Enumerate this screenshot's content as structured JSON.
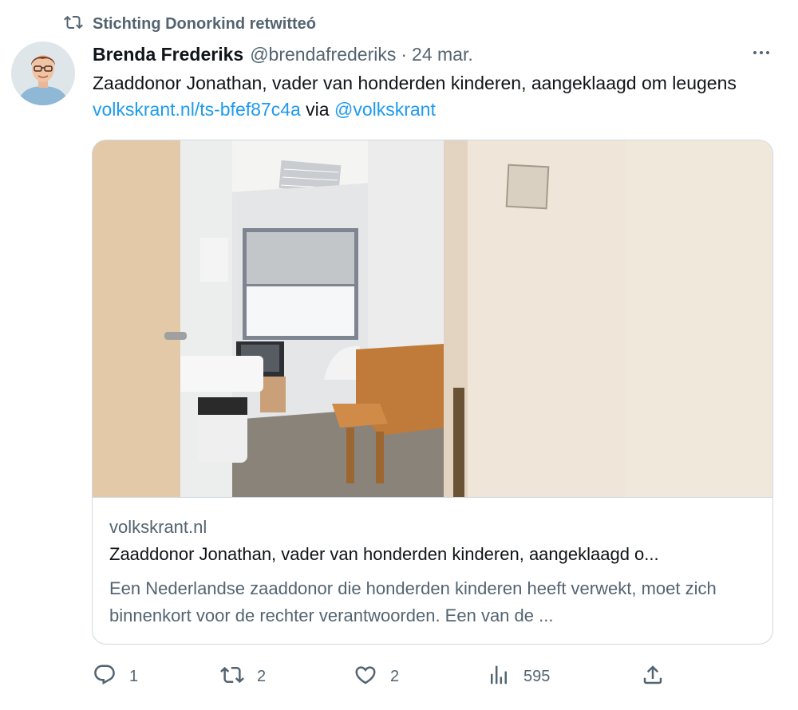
{
  "retweet_banner": {
    "icon": "retweet-icon",
    "label": "Stichting Donorkind retwitteó"
  },
  "tweet": {
    "author_name": "Brenda Frederiks",
    "handle": "@brendafrederiks",
    "separator": "·",
    "date": "24 mar.",
    "more_icon": "more-icon",
    "text_prefix": "Zaaddonor Jonathan, vader van honderden kinderen, aangeklaagd om leugens ",
    "link_text": "volkskrant.nl/ts-bfef87c4a",
    "via_text": " via ",
    "mention": "@volkskrant"
  },
  "card": {
    "domain": "volkskrant.nl",
    "title": "Zaaddonor Jonathan, vader van honderden kinderen, aangeklaagd o...",
    "description": "Een Nederlandse zaaddonor die honderden kinderen heeft verwekt, moet zich binnenkort voor de rechter verantwoorden. Een van de ..."
  },
  "actions": {
    "reply": {
      "icon": "reply-icon",
      "count": "1"
    },
    "retweet": {
      "icon": "retweet-icon",
      "count": "2"
    },
    "like": {
      "icon": "heart-icon",
      "count": "2"
    },
    "views": {
      "icon": "views-icon",
      "count": "595"
    },
    "share": {
      "icon": "share-icon"
    }
  },
  "colors": {
    "accent": "#1d9bf0",
    "secondary_text": "#536471",
    "primary_text": "#0f1419",
    "border": "#cfd9de"
  }
}
